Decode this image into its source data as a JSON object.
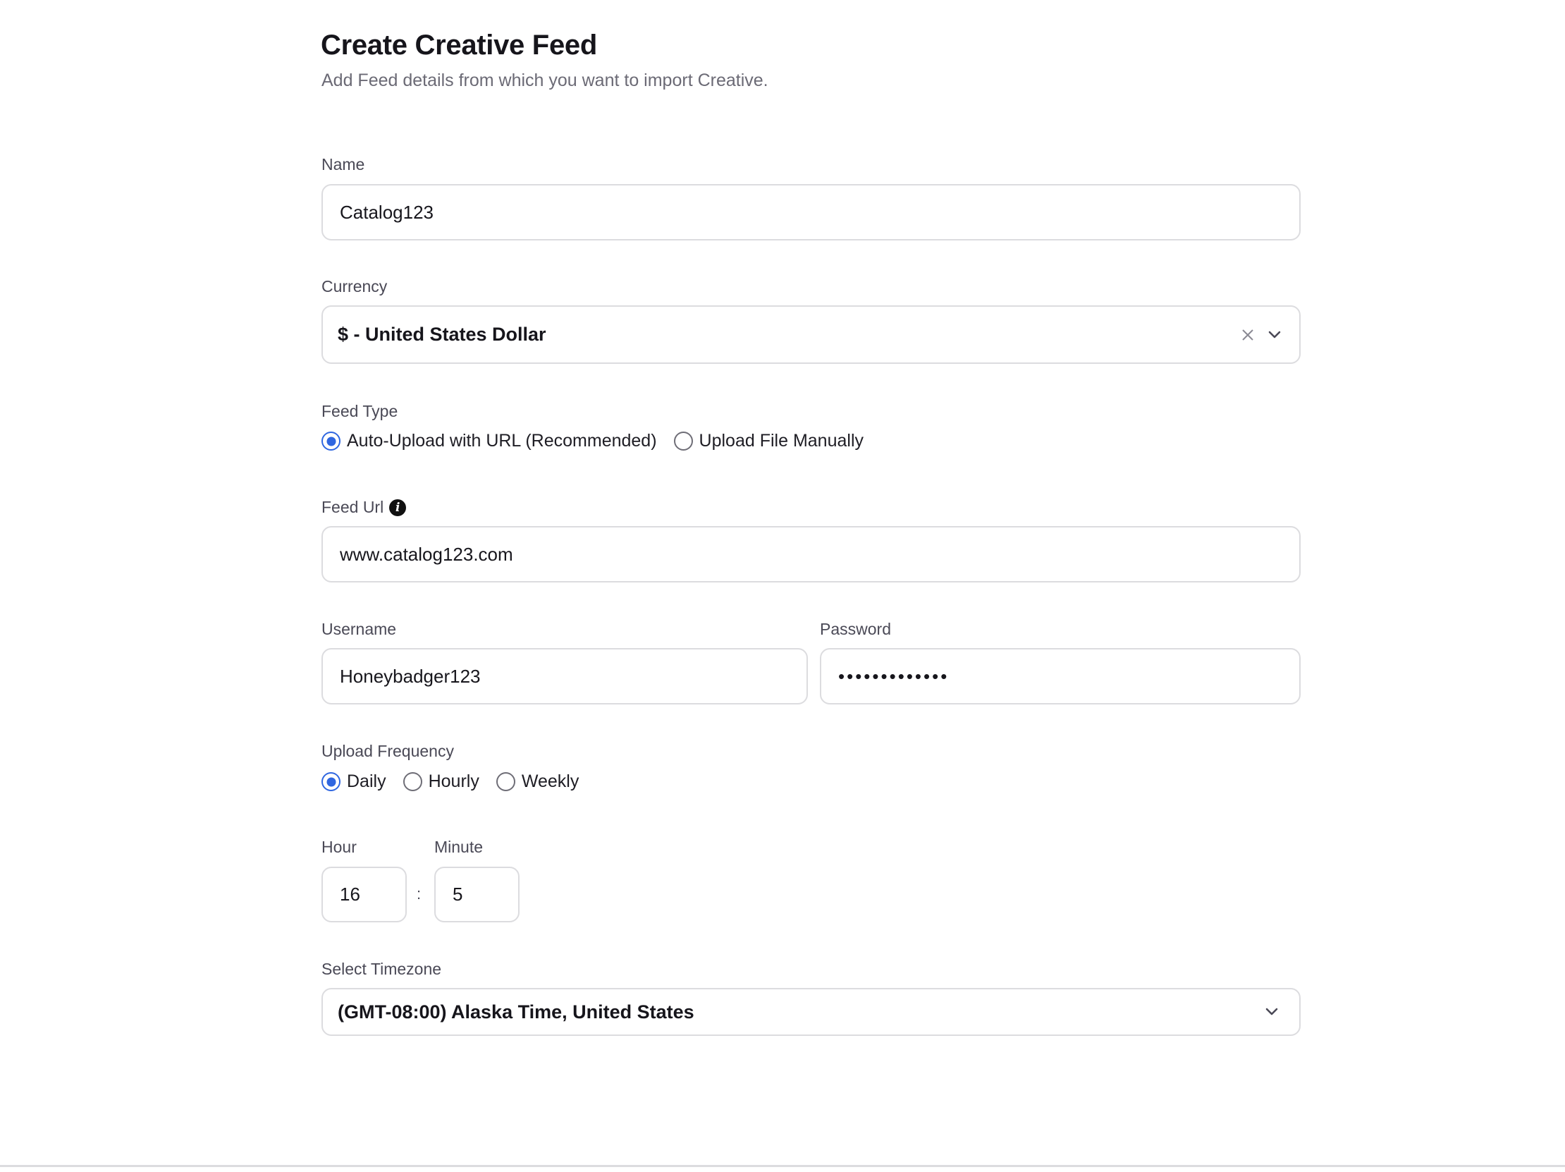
{
  "header": {
    "title": "Create Creative Feed",
    "subtitle": "Add Feed details from which you want to import Creative."
  },
  "form": {
    "name": {
      "label": "Name",
      "value": "Catalog123"
    },
    "currency": {
      "label": "Currency",
      "value": "$ - United States Dollar",
      "clear_icon": "close-icon",
      "dropdown_icon": "chevron-down-icon"
    },
    "feed_type": {
      "label": "Feed Type",
      "options": [
        {
          "label": "Auto-Upload with URL (Recommended)",
          "checked": true
        },
        {
          "label": "Upload File Manually",
          "checked": false
        }
      ]
    },
    "feed_url": {
      "label": "Feed Url",
      "info_icon": "info-icon",
      "value": "www.catalog123.com"
    },
    "username": {
      "label": "Username",
      "value": "Honeybadger123"
    },
    "password": {
      "label": "Password",
      "masked_value": "•••••••••••••"
    },
    "upload_frequency": {
      "label": "Upload Frequency",
      "options": [
        {
          "label": "Daily",
          "checked": true
        },
        {
          "label": "Hourly",
          "checked": false
        },
        {
          "label": "Weekly",
          "checked": false
        }
      ]
    },
    "time": {
      "hour": {
        "label": "Hour",
        "value": "16"
      },
      "separator": ":",
      "minute": {
        "label": "Minute",
        "value": "5"
      }
    },
    "timezone": {
      "label": "Select Timezone",
      "value": "(GMT-08:00) Alaska Time, United States",
      "dropdown_icon": "chevron-down-icon"
    }
  },
  "colors": {
    "accent": "#2f66e0",
    "border": "#dcdcdf",
    "label": "#4a4956",
    "text": "#16151b"
  }
}
